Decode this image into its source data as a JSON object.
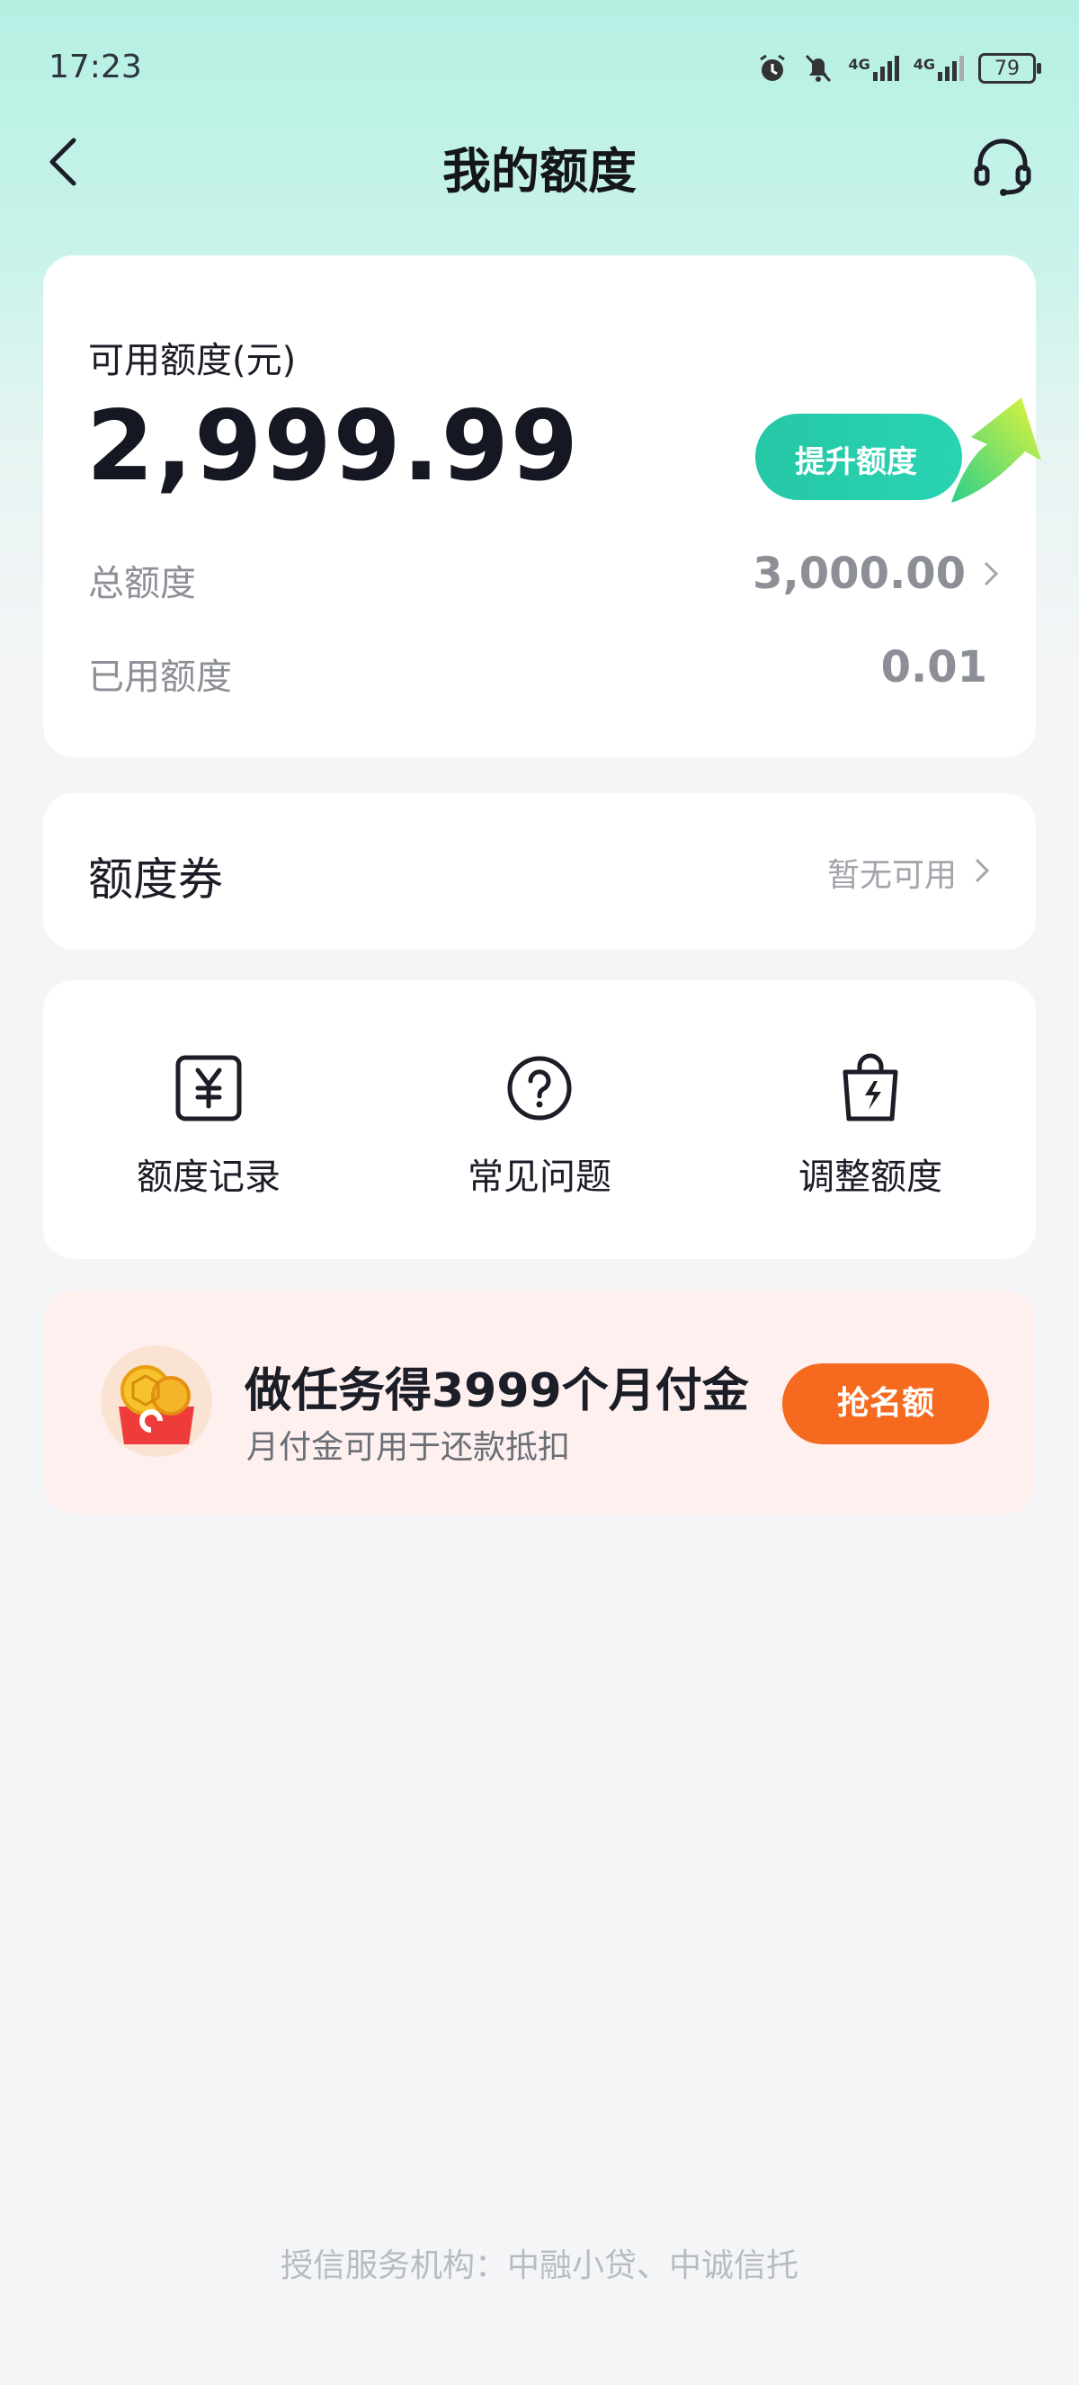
{
  "status_bar": {
    "time": "17:23",
    "battery": "79",
    "network_1": "4G",
    "network_2": "4G"
  },
  "header": {
    "title": "我的额度"
  },
  "quota_card": {
    "available_label": "可用额度(元)",
    "available_amount": "2,999.99",
    "raise_button_label": "提升额度",
    "total_label": "总额度",
    "total_value": "3,000.00",
    "used_label": "已用额度",
    "used_value": "0.01"
  },
  "voucher_card": {
    "title": "额度券",
    "status": "暂无可用"
  },
  "menu": {
    "items": [
      {
        "label": "额度记录",
        "icon": "yuan-receipt-icon"
      },
      {
        "label": "常见问题",
        "icon": "question-circle-icon"
      },
      {
        "label": "调整额度",
        "icon": "lightning-bag-icon"
      }
    ]
  },
  "promo": {
    "title": "做任务得3999个月付金",
    "subtitle": "月付金可用于还款抵扣",
    "button_label": "抢名额"
  },
  "footer": {
    "text": "授信服务机构：中融小贷、中诚信托"
  },
  "colors": {
    "accent_green": "#25c7a6",
    "promo_button": "#f56a1f",
    "promo_bg": "#fdf0ef"
  }
}
